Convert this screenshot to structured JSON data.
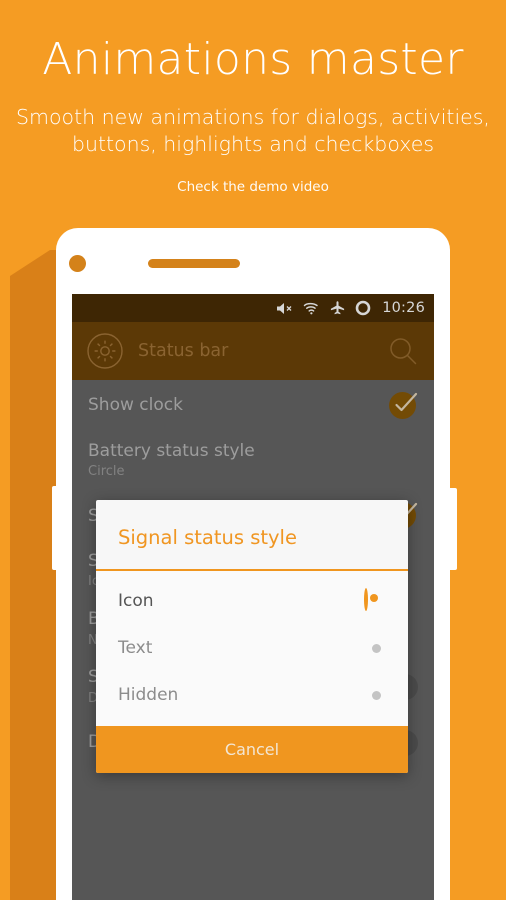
{
  "promo": {
    "title": "Animations master",
    "subtitle": "Smooth new animations for dialogs, activities, buttons, highlights and checkboxes",
    "note": "Check the demo video"
  },
  "colors": {
    "page_background": "#F59C23",
    "phone_shadow": "#D98018",
    "phone_body": "#FFFFFF",
    "status_bar": "#4A2E05",
    "app_bar": "#6E4508",
    "screen_background": "#676767",
    "accent_orange": "#F0961F",
    "dialog_background": "#F7F7F7",
    "checked_toggle": "#8A5A06",
    "unchecked_toggle": "#5A5A5A"
  },
  "phone": {
    "statusbar": {
      "time": "10:26",
      "icons": [
        "volume-mute-icon",
        "wifi-icon",
        "airplane-mode-icon",
        "battery-circle-icon"
      ]
    },
    "appbar": {
      "gear_icon": "gear-icon",
      "title": "Status bar",
      "search_icon": "search-icon"
    },
    "settings": [
      {
        "title": "Show clock",
        "subtitle": "",
        "control": "checkbox",
        "state": "on"
      },
      {
        "title": "Battery status style",
        "subtitle": "Circle",
        "control": "none",
        "state": ""
      },
      {
        "title": "Show",
        "subtitle": "",
        "control": "checkbox",
        "state": "on"
      },
      {
        "title": "Signal status style",
        "subtitle": "Icon",
        "control": "none",
        "state": ""
      },
      {
        "title": "Brightness",
        "subtitle": "Not enabled",
        "control": "none",
        "state": ""
      },
      {
        "title": "Show",
        "subtitle": "Display",
        "control": "checkbox",
        "state": "off"
      },
      {
        "title": "Double-tap to sleep",
        "subtitle": "",
        "control": "checkbox",
        "state": "off"
      }
    ]
  },
  "dialog": {
    "title": "Signal status style",
    "options": [
      {
        "label": "Icon",
        "selected": true
      },
      {
        "label": "Text",
        "selected": false
      },
      {
        "label": "Hidden",
        "selected": false
      }
    ],
    "cancel_label": "Cancel"
  }
}
